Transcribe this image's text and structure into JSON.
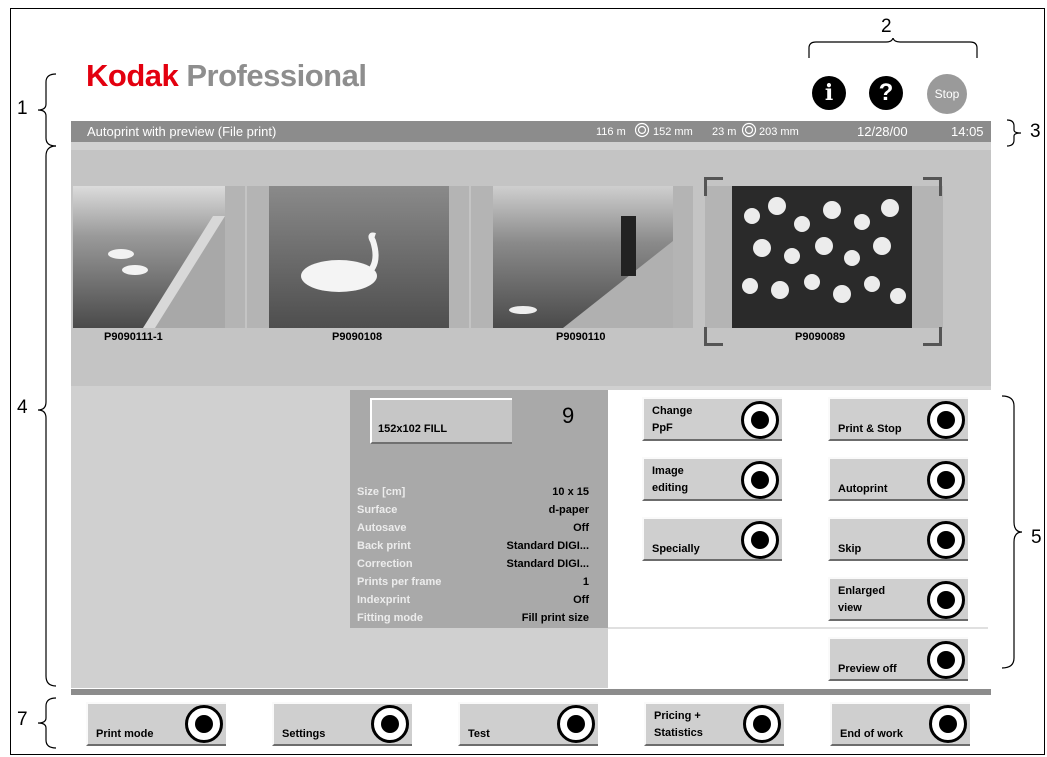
{
  "callouts": {
    "one": "1",
    "two": "2",
    "three": "3",
    "four": "4",
    "five": "5",
    "seven": "7"
  },
  "logo": {
    "brand": "Kodak",
    "product": "Professional"
  },
  "top_icons": {
    "info": "i",
    "help": "?",
    "stop_label": "Stop"
  },
  "titlebar": {
    "mode": "Autoprint with preview (File print)",
    "paper_1_length": "116 m",
    "paper_1_width": "152 mm",
    "paper_2_length": "23 m",
    "paper_2_width": "203 mm",
    "date": "12/28/00",
    "time": "14:05"
  },
  "thumbnails": [
    {
      "label": "P9090111-1"
    },
    {
      "label": "P9090108"
    },
    {
      "label": "P9090110"
    },
    {
      "label": "P9090089"
    }
  ],
  "settings": {
    "pfp_label": "152x102 FILL",
    "callout": "9",
    "rows": [
      {
        "key": "Size [cm]",
        "value": "10 x 15"
      },
      {
        "key": "Surface",
        "value": "d-paper"
      },
      {
        "key": "Autosave",
        "value": "Off"
      },
      {
        "key": "Back print",
        "value": "Standard DIGI..."
      },
      {
        "key": "Correction",
        "value": "Standard DIGI..."
      },
      {
        "key": "Prints per frame",
        "value": "1"
      },
      {
        "key": "Indexprint",
        "value": "Off"
      },
      {
        "key": "Fitting mode",
        "value": "Fill  print size"
      }
    ]
  },
  "side_buttons": {
    "change_ppf": {
      "line1": "Change",
      "line2": "PpF"
    },
    "image_editing": {
      "line1": "Image",
      "line2": "editing"
    },
    "specially": "Specially",
    "print_stop": "Print & Stop",
    "autoprint": "Autoprint",
    "skip": "Skip",
    "enlarged": {
      "line1": "Enlarged",
      "line2": "view"
    },
    "preview_off": "Preview off"
  },
  "bottom_buttons": {
    "print_mode": "Print mode",
    "settings": "Settings",
    "test": "Test",
    "pricing": {
      "line1": "Pricing +",
      "line2": "Statistics"
    },
    "end_of_work": "End of work"
  },
  "colors": {
    "brand_red": "#e3000f",
    "brand_gray": "#8e8e8e",
    "panel_gray": "#a9a9a9",
    "titlebar": "#8c8c8c"
  }
}
